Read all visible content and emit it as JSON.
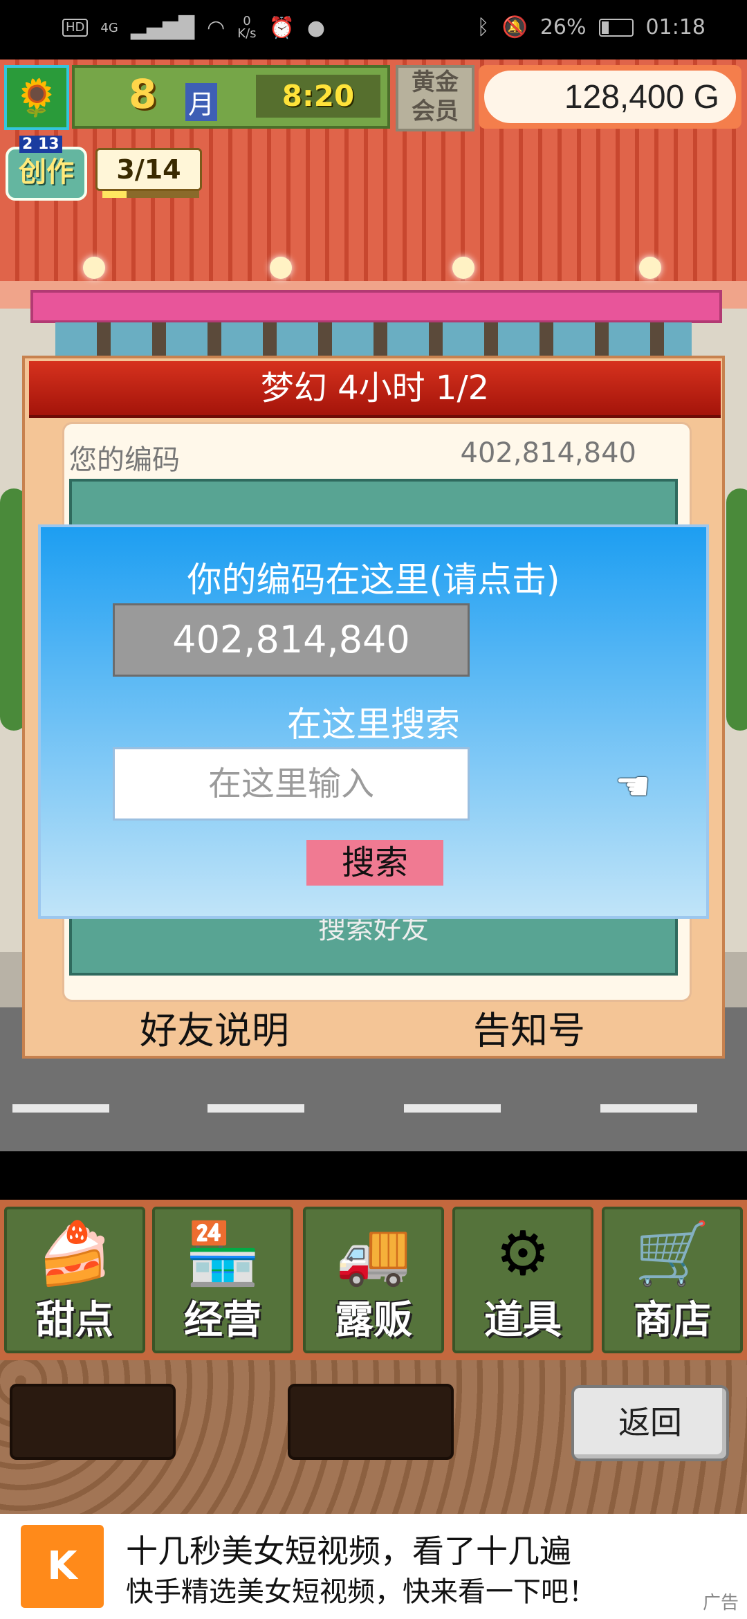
{
  "status_bar": {
    "hd": "HD",
    "net": "4G",
    "speed_value": "0",
    "speed_unit": "K/s",
    "battery": "26%",
    "time": "01:18"
  },
  "hud": {
    "month_num": "8",
    "month_unit": "月",
    "time": "8:20",
    "vip_line1": "黄金",
    "vip_line2": "会员",
    "money": "128,400 G"
  },
  "create": {
    "badge": "创作",
    "level": "2 13",
    "count": "3/14",
    "progress": 0.25
  },
  "friend_panel": {
    "title": "梦幻  4小时 1/2",
    "code_label": "您的编码",
    "code_value": "402,814,840",
    "search_friend_label": "搜索好友",
    "help_button": "好友说明",
    "notice_button": "告知号"
  },
  "search_dialog": {
    "title": "你的编码在这里(请点击)",
    "code": "402,814,840",
    "search_heading": "在这里搜索",
    "input_value": "",
    "input_placeholder": "在这里输入",
    "search_button": "搜索"
  },
  "menu": {
    "items": [
      {
        "label": "甜点",
        "icon": "cake-icon",
        "glyph": "🍰"
      },
      {
        "label": "经营",
        "icon": "shop-building-icon",
        "glyph": "🏪"
      },
      {
        "label": "露贩",
        "icon": "food-truck-icon",
        "glyph": "🚚"
      },
      {
        "label": "道具",
        "icon": "gear-bag-icon",
        "glyph": "⚙"
      },
      {
        "label": "商店",
        "icon": "shopping-cart-icon",
        "glyph": "🛒"
      }
    ],
    "back_button": "返回"
  },
  "ad": {
    "logo": "K",
    "line1": "十几秒美女短视频，看了十几遍",
    "line2": "快手精选美女短视频，快来看一下吧！",
    "tag": "广告"
  }
}
